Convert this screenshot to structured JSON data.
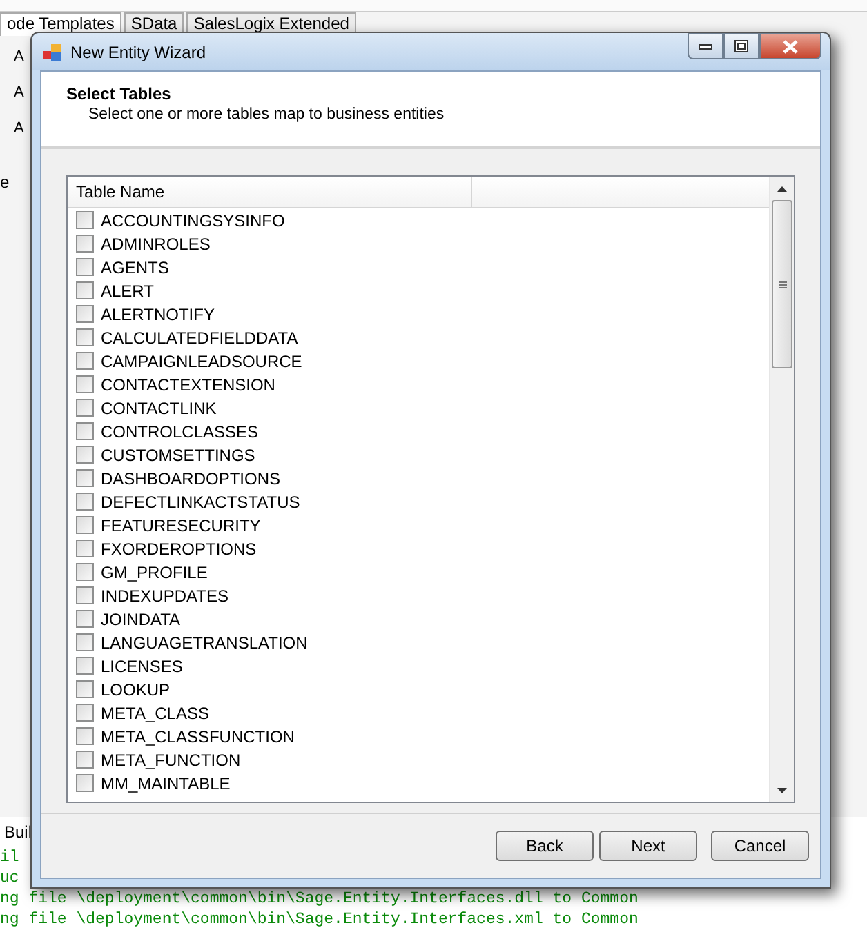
{
  "background": {
    "tabs": [
      {
        "label": "ode Templates",
        "selected": true
      },
      {
        "label": "SData",
        "selected": false
      },
      {
        "label": "SalesLogix Extended",
        "selected": false
      }
    ],
    "side_fragments": [
      "A",
      "A",
      "A"
    ],
    "column_fragment": "e",
    "build_tab": "Buil",
    "output_lines": [
      "il",
      "uc",
      "ng file \\deployment\\common\\bin\\Sage.Entity.Interfaces.dll to Common",
      "ng file \\deployment\\common\\bin\\Sage.Entity.Interfaces.xml to Common"
    ]
  },
  "window": {
    "title": "New Entity Wizard"
  },
  "header": {
    "title": "Select Tables",
    "subtitle": "Select one or more tables map to business entities"
  },
  "table": {
    "columns": [
      "Table Name"
    ],
    "rows": [
      {
        "name": "ACCOUNTINGSYSINFO",
        "checked": false
      },
      {
        "name": "ADMINROLES",
        "checked": false
      },
      {
        "name": "AGENTS",
        "checked": false
      },
      {
        "name": "ALERT",
        "checked": false
      },
      {
        "name": "ALERTNOTIFY",
        "checked": false
      },
      {
        "name": "CALCULATEDFIELDDATA",
        "checked": false
      },
      {
        "name": "CAMPAIGNLEADSOURCE",
        "checked": false
      },
      {
        "name": "CONTACTEXTENSION",
        "checked": false
      },
      {
        "name": "CONTACTLINK",
        "checked": false
      },
      {
        "name": "CONTROLCLASSES",
        "checked": false
      },
      {
        "name": "CUSTOMSETTINGS",
        "checked": false
      },
      {
        "name": "DASHBOARDOPTIONS",
        "checked": false
      },
      {
        "name": "DEFECTLINKACTSTATUS",
        "checked": false
      },
      {
        "name": "FEATURESECURITY",
        "checked": false
      },
      {
        "name": "FXORDEROPTIONS",
        "checked": false
      },
      {
        "name": "GM_PROFILE",
        "checked": false
      },
      {
        "name": "INDEXUPDATES",
        "checked": false
      },
      {
        "name": "JOINDATA",
        "checked": false
      },
      {
        "name": "LANGUAGETRANSLATION",
        "checked": false
      },
      {
        "name": "LICENSES",
        "checked": false
      },
      {
        "name": "LOOKUP",
        "checked": false
      },
      {
        "name": "META_CLASS",
        "checked": false
      },
      {
        "name": "META_CLASSFUNCTION",
        "checked": false
      },
      {
        "name": "META_FUNCTION",
        "checked": false
      },
      {
        "name": "MM_MAINTABLE",
        "checked": false
      }
    ]
  },
  "buttons": [
    "Back",
    "Next",
    "Cancel"
  ]
}
